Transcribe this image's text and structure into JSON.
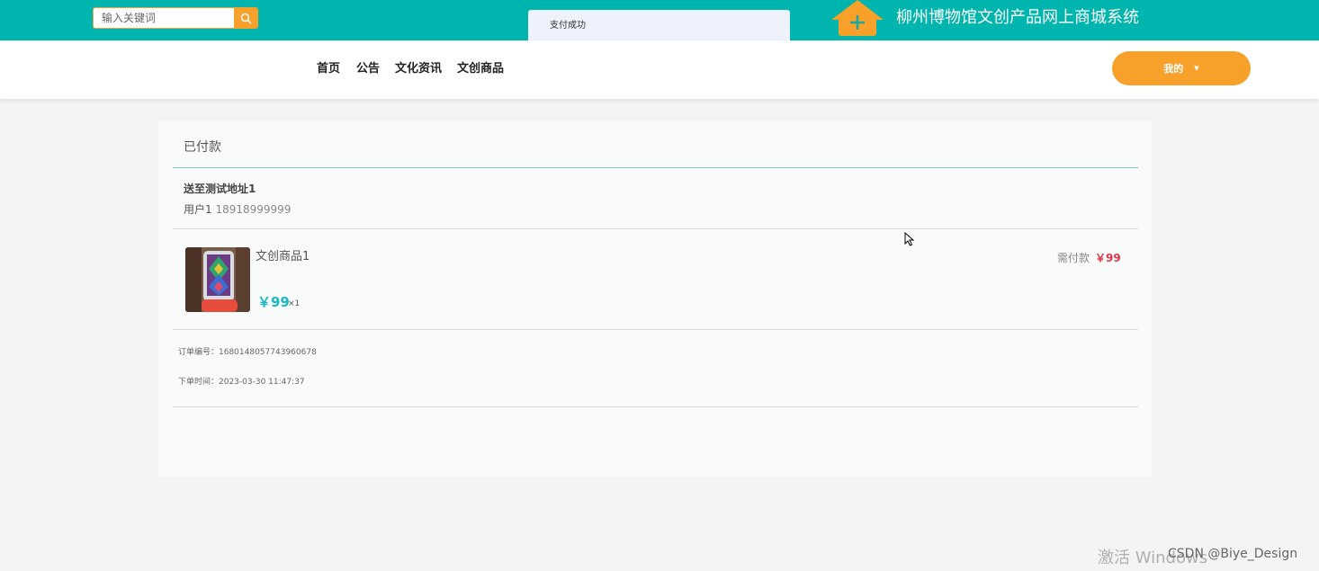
{
  "header": {
    "search_placeholder": "输入关键词",
    "toast": "支付成功",
    "site_title": "柳州博物馆文创产品网上商城系统"
  },
  "nav": {
    "items": [
      "首页",
      "公告",
      "文化资讯",
      "文创商品"
    ],
    "my_label": "我的"
  },
  "order": {
    "status": "已付款",
    "address": "送至测试地址1",
    "user": "用户1",
    "phone": "18918999999",
    "product_name": "文创商品1",
    "product_price": "￥99",
    "product_qty": "×1",
    "need_pay_label": "需付款",
    "need_pay_amount": "￥99",
    "order_no": "订单编号：1680148057743960678",
    "order_time": "下单时间：2023-03-30 11:47:37"
  },
  "overlay": {
    "watermark": "激活 Windows",
    "csdn": "CSDN @Biye_Design"
  },
  "colors": {
    "teal": "#00b5ad",
    "orange": "#f7a02a",
    "price": "#19b8c5",
    "pay": "#e03448"
  }
}
